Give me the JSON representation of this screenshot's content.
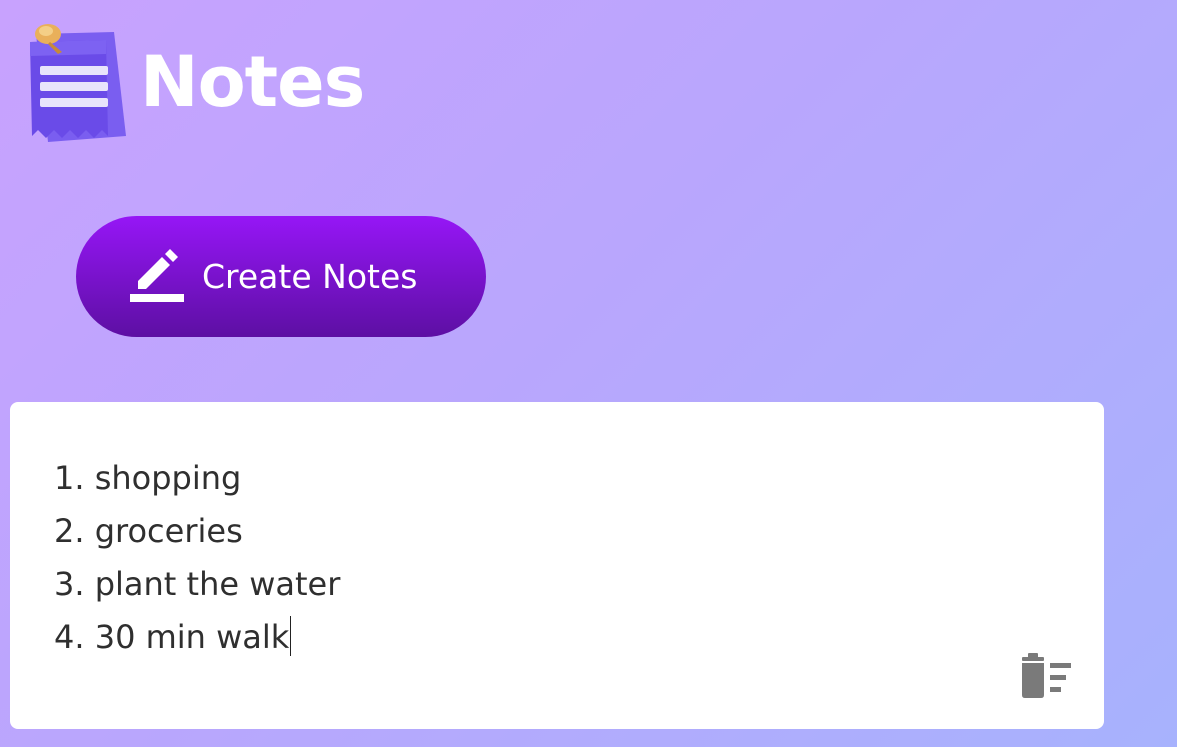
{
  "header": {
    "logo_icon": "notepad-pin-icon",
    "title": "Notes",
    "title_color": "#ffffff"
  },
  "toolbar": {
    "create_label": "Create Notes",
    "create_icon": "edit-pencil-icon",
    "button_color": "#8b14ef"
  },
  "notes": [
    {
      "lines": [
        "1. shopping",
        "2. groceries",
        "3. plant the water",
        "4. 30 min walk"
      ],
      "delete_icon": "delete-sweep-icon"
    }
  ]
}
